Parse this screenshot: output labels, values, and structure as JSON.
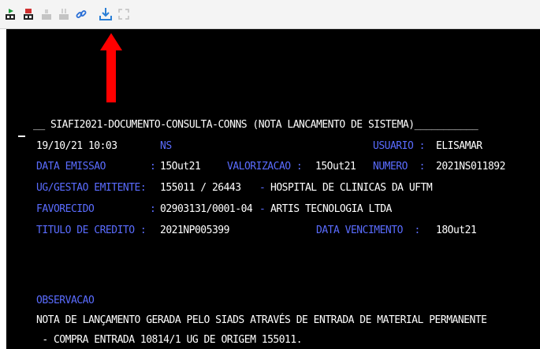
{
  "toolbar": {
    "buttons": [
      {
        "name": "play-icon",
        "color": "#1a9a3a"
      },
      {
        "name": "stop-icon",
        "color": "#d03030"
      },
      {
        "name": "disabled-icon-1",
        "color": "#b8b8b8"
      },
      {
        "name": "disabled-icon-2",
        "color": "#b8b8b8"
      },
      {
        "name": "link-icon",
        "color": "#2a6fd6"
      },
      {
        "name": "download-icon",
        "color": "#2a7fd6"
      },
      {
        "name": "expand-icon",
        "color": "#c0c0c0"
      }
    ]
  },
  "annotation": {
    "arrow_color": "#ff0000",
    "points_to": "download-icon"
  },
  "terminal": {
    "title_prefix": "__ ",
    "title": "SIAFI2021-DOCUMENTO-CONSULTA-CONNS (NOTA LANCAMENTO DE SISTEMA)",
    "title_suffix": "___________",
    "date": "19/10/21",
    "time": "10:03",
    "doc_type": "NS",
    "usuario_label": "USUARIO :",
    "usuario_value": "ELISAMAR",
    "data_emissao_label": "DATA EMISSAO",
    "data_emissao_sep": ":",
    "data_emissao_value": "15Out21",
    "valorizacao_label": "VALORIZACAO :",
    "valorizacao_value": "15Out21",
    "numero_label": "NUMERO  :",
    "numero_value": "2021NS011892",
    "ug_label": "UG/GESTAO EMITENTE:",
    "ug_code": "155011 / 26443",
    "ug_dash": "-",
    "ug_name": "HOSPITAL DE CLINICAS DA UFTM",
    "favorecido_label": "FAVORECIDO",
    "favorecido_sep": ":",
    "favorecido_cnpj": "02903131/0001-04",
    "favorecido_dash": "-",
    "favorecido_name": "ARTIS TECNOLOGIA LTDA",
    "titulo_label": "TITULO DE CREDITO :",
    "titulo_value": "2021NP005399",
    "vencimento_label": "DATA VENCIMENTO  :",
    "vencimento_value": "18Out21",
    "observacao_label": "OBSERVACAO",
    "observacao_line1": "NOTA DE LANÇAMENTO GERADA PELO SIADS ATRAVÉS DE ENTRADA DE MATERIAL PERMANENTE",
    "observacao_line2": " - COMPRA ENTRADA 10814/1 UG DE ORIGEM 155011."
  }
}
